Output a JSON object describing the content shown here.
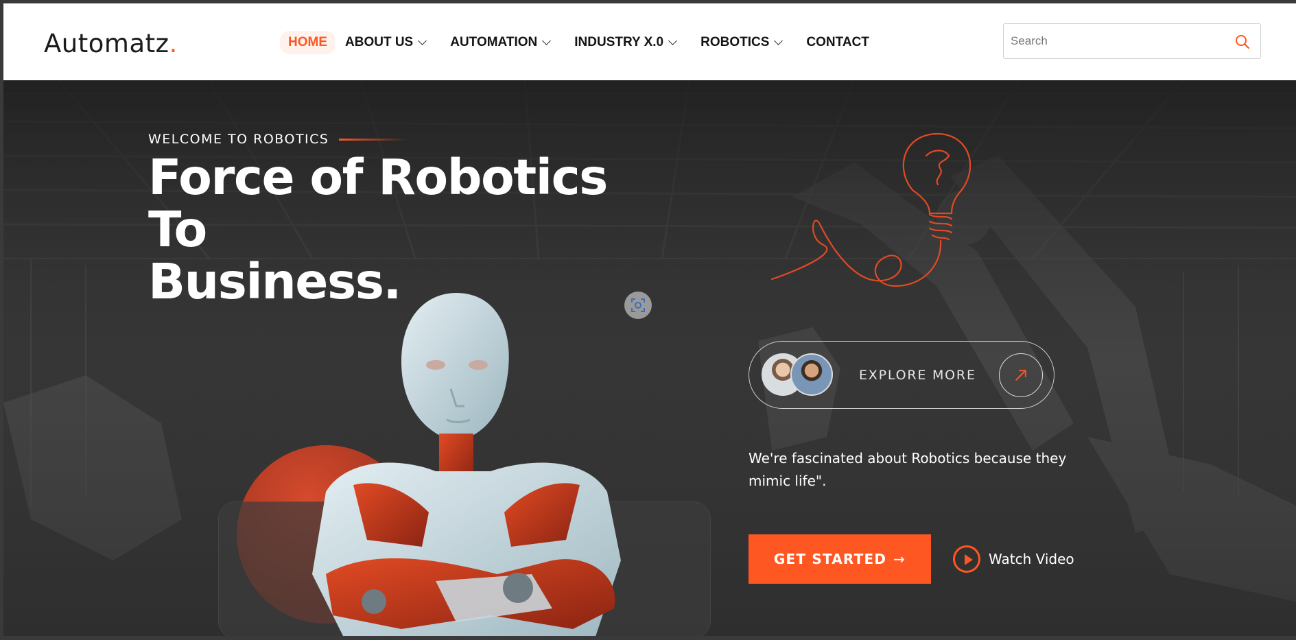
{
  "header": {
    "logo_text": "Automatz",
    "logo_dot": ".",
    "nav": [
      {
        "label": "HOME",
        "active": true,
        "dropdown": false
      },
      {
        "label": "ABOUT US",
        "active": false,
        "dropdown": true
      },
      {
        "label": "AUTOMATION",
        "active": false,
        "dropdown": true
      },
      {
        "label": "INDUSTRY X.0",
        "active": false,
        "dropdown": true
      },
      {
        "label": "ROBOTICS",
        "active": false,
        "dropdown": true
      },
      {
        "label": "CONTACT",
        "active": false,
        "dropdown": false
      }
    ],
    "search": {
      "placeholder": "Search",
      "value": "",
      "icon": "search-icon"
    }
  },
  "hero": {
    "eyebrow": "WELCOME TO ROBOTICS",
    "title_line1": "Force of Robotics To",
    "title_line2": "Business.",
    "explore_label": "EXPLORE MORE",
    "tagline": "We're fascinated about Robotics because they mimic life\".",
    "cta_label": "GET STARTED",
    "cta_arrow": "→",
    "watch_label": "Watch Video"
  },
  "colors": {
    "accent": "#ff5722",
    "header_bg": "#ffffff",
    "hero_bg": "#2f2f2f",
    "text_light": "#ffffff",
    "text_dark": "#141414"
  }
}
